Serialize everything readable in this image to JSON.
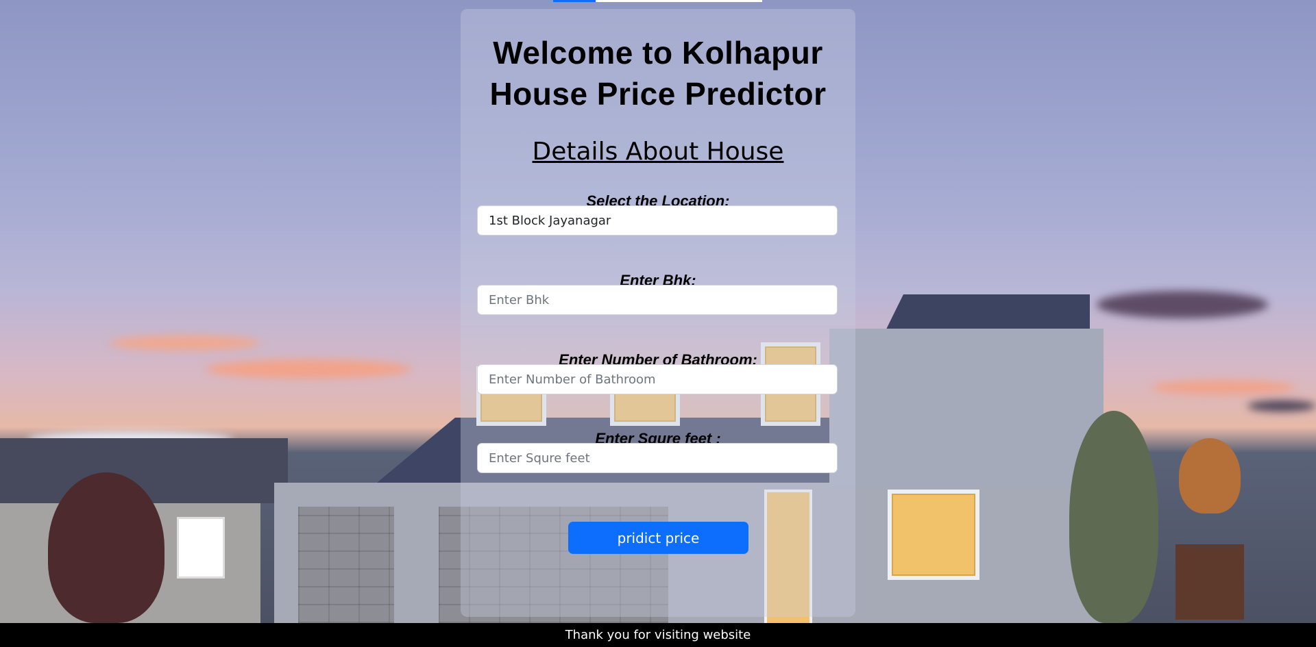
{
  "page": {
    "title": "Welcome to Kolhapur House Price Predictor",
    "subtitle": "Details About House"
  },
  "form": {
    "location_label": "Select the Location:",
    "location_value": "1st Block Jayanagar",
    "bhk_label": "Enter Bhk:",
    "bhk_placeholder": "Enter Bhk",
    "bath_label": "Enter Number of Bathroom:",
    "bath_placeholder": "Enter Number of Bathroom",
    "sqft_label": "Enter Squre feet :",
    "sqft_placeholder": "Enter Squre feet",
    "submit_label": "pridict price"
  },
  "footer": {
    "text": "Thank you for visiting website"
  },
  "colors": {
    "accent": "#0d6efd",
    "footer_bg": "#000000"
  }
}
